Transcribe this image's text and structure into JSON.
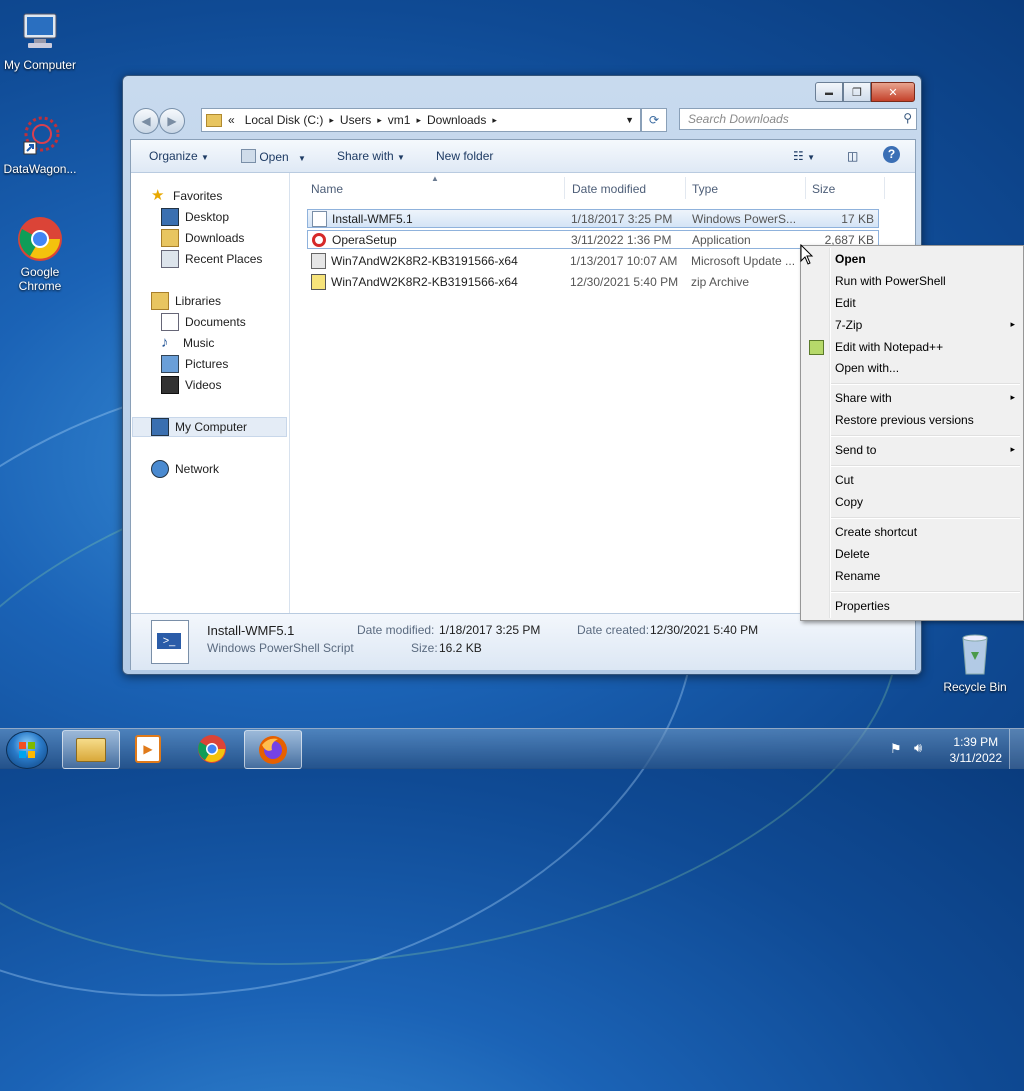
{
  "desktop": {
    "icons": [
      {
        "label": "My Computer",
        "icon": "computer-icon"
      },
      {
        "label": "DataWagon...",
        "icon": "datawagon-icon"
      },
      {
        "label": "Google Chrome",
        "icon": "chrome-icon"
      },
      {
        "label": "Recycle Bin",
        "icon": "recycle-bin-icon"
      }
    ]
  },
  "window": {
    "buttons": {
      "minimize": "▬",
      "maximize": "❐",
      "close": "✕"
    },
    "breadcrumb": {
      "overflow": "«",
      "items": [
        "Local Disk (C:)",
        "Users",
        "vm1",
        "Downloads"
      ],
      "sep": "▸"
    },
    "search_placeholder": "Search Downloads",
    "toolbar": {
      "organize": "Organize",
      "open": "Open",
      "share_with": "Share with",
      "new_folder": "New folder"
    },
    "nav": {
      "favorites": "Favorites",
      "desktop": "Desktop",
      "downloads": "Downloads",
      "recent_places": "Recent Places",
      "libraries": "Libraries",
      "documents": "Documents",
      "music": "Music",
      "pictures": "Pictures",
      "videos": "Videos",
      "my_computer": "My Computer",
      "network": "Network"
    },
    "columns": {
      "name": "Name",
      "date": "Date modified",
      "type": "Type",
      "size": "Size"
    },
    "files": [
      {
        "name": "Install-WMF5.1",
        "date": "1/18/2017 3:25 PM",
        "type": "Windows PowerS...",
        "size": "17 KB",
        "icon": "powershell-script-icon"
      },
      {
        "name": "OperaSetup",
        "date": "3/11/2022 1:36 PM",
        "type": "Application",
        "size": "2,687 KB",
        "icon": "opera-icon"
      },
      {
        "name": "Win7AndW2K8R2-KB3191566-x64",
        "date": "1/13/2017 10:07 AM",
        "type": "Microsoft Update ...",
        "size": "",
        "icon": "msu-icon"
      },
      {
        "name": "Win7AndW2K8R2-KB3191566-x64",
        "date": "12/30/2021 5:40 PM",
        "type": "zip Archive",
        "size": "",
        "icon": "zip-icon"
      }
    ],
    "details": {
      "name": "Install-WMF5.1",
      "type": "Windows PowerShell Script",
      "modified_label": "Date modified:",
      "modified": "1/18/2017 3:25 PM",
      "size_label": "Size:",
      "size": "16.2 KB",
      "created_label": "Date created:",
      "created": "12/30/2021 5:40 PM"
    }
  },
  "context_menu": {
    "items": [
      {
        "label": "Open"
      },
      {
        "label": "Run with PowerShell"
      },
      {
        "label": "Edit"
      },
      {
        "label": "7-Zip",
        "submenu": "▸"
      },
      {
        "label": "Edit with Notepad++"
      },
      {
        "label": "Open with..."
      },
      {
        "label": "Share with",
        "submenu": "▸"
      },
      {
        "label": "Restore previous versions"
      },
      {
        "label": "Send to",
        "submenu": "▸"
      },
      {
        "label": "Cut"
      },
      {
        "label": "Copy"
      },
      {
        "label": "Create shortcut"
      },
      {
        "label": "Delete"
      },
      {
        "label": "Rename"
      },
      {
        "label": "Properties"
      }
    ]
  },
  "taskbar": {
    "time": "1:39 PM",
    "date": "3/11/2022",
    "pinned": [
      "explorer-icon",
      "media-player-icon",
      "chrome-icon",
      "firefox-icon"
    ]
  }
}
